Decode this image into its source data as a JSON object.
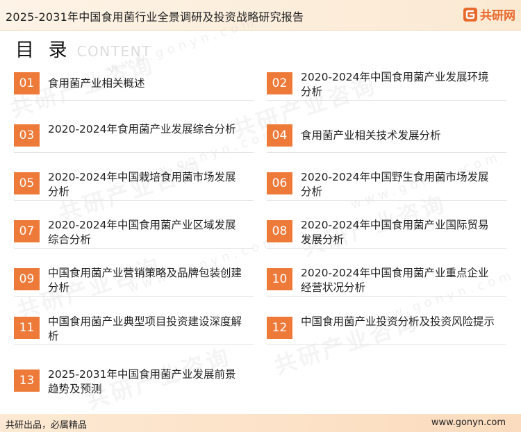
{
  "header": {
    "title": "2025-2031年中国食用菌行业全景调研及投资战略研究报告",
    "brand_name": "共研网",
    "brand_color": "#e8692c"
  },
  "heading": {
    "main": "目 录",
    "sub": "CONTENT"
  },
  "watermark": {
    "text": "共研产业咨询",
    "url": "www.gonyn.com"
  },
  "accent_color": "#ee7a3a",
  "toc": [
    {
      "num": "01",
      "label": "食用菌产业相关概述"
    },
    {
      "num": "02",
      "label": "2020-2024年中国食用菌产业发展环境分析"
    },
    {
      "num": "03",
      "label": "2020-2024年食用菌产业发展综合分析"
    },
    {
      "num": "04",
      "label": "食用菌产业相关技术发展分析"
    },
    {
      "num": "05",
      "label": "2020-2024年中国栽培食用菌市场发展分析"
    },
    {
      "num": "06",
      "label": "2020-2024年中国野生食用菌市场发展分析"
    },
    {
      "num": "07",
      "label": "2020-2024年中国食用菌产业区域发展综合分析"
    },
    {
      "num": "08",
      "label": "2020-2024年中国食用菌产业国际贸易发展分析"
    },
    {
      "num": "09",
      "label": "中国食用菌产业营销策略及品牌包装创建分析"
    },
    {
      "num": "10",
      "label": "2020-2024年中国食用菌产业重点企业经营状况分析"
    },
    {
      "num": "11",
      "label": "中国食用菌产业典型项目投资建设深度解析"
    },
    {
      "num": "12",
      "label": "中国食用菌产业投资分析及投资风险提示"
    },
    {
      "num": "13",
      "label": "2025-2031年中国食用菌产业发展前景趋势及预测"
    }
  ],
  "footer": {
    "left": "共研出品，必属精品",
    "right": "www.gonyn.com"
  }
}
